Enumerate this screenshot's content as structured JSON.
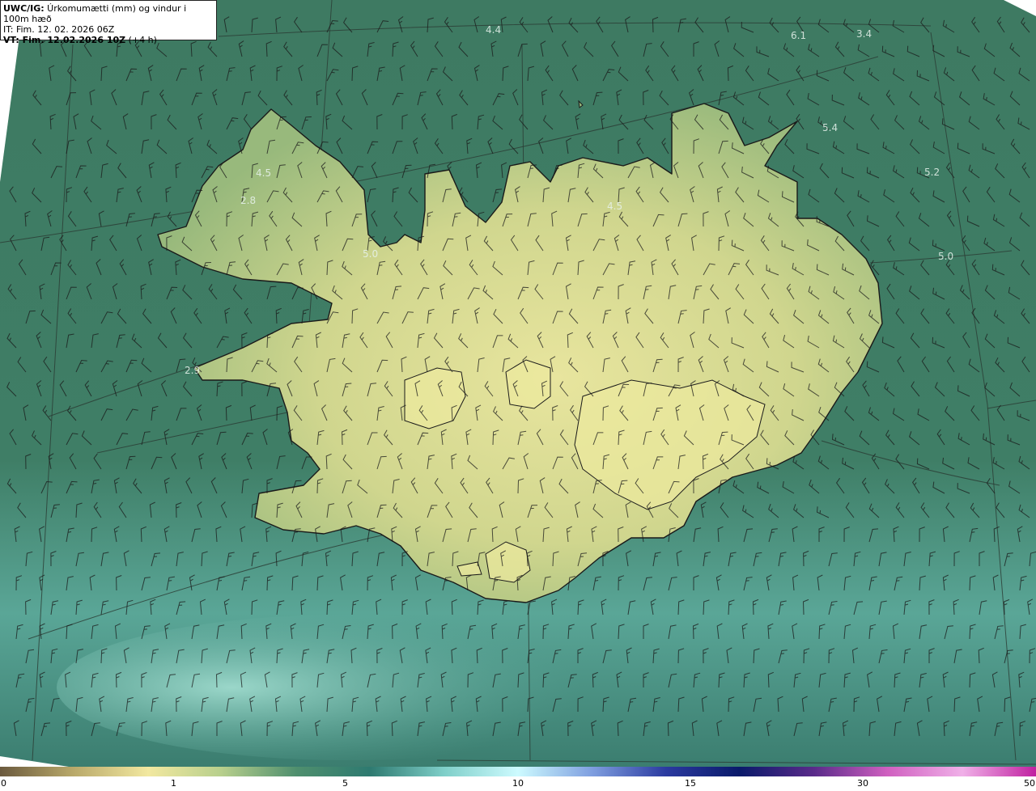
{
  "header": {
    "line1_prefix": "UWC/IG:",
    "line1_text": " Úrkomumætti (mm) og vindur i 100m hæð",
    "line2": "IT: Fim. 12. 02. 2026 06Z",
    "line3_prefix": "VT: Fim. 12.02.2026 10Z",
    "line3_suffix": " (+4 h)"
  },
  "point_labels": [
    "4.4",
    "6.1",
    "3.4",
    "5.4",
    "5.2",
    "4.5",
    "2.8",
    "5.0",
    "4.5",
    "5.0",
    "2.9"
  ],
  "colorbar": {
    "ticks": [
      "0",
      "1",
      "5",
      "10",
      "15",
      "30",
      "50"
    ],
    "colors": [
      "#6b5a3e",
      "#b9a96a",
      "#f2e8a0",
      "#b7cf8c",
      "#4f8f6e",
      "#2e7a70",
      "#7fcfc9",
      "#cdfbff",
      "#7f9fe0",
      "#2b3aa0",
      "#0a1a6a",
      "#5a2b8a",
      "#d060c0",
      "#f0b0e8",
      "#c020a0"
    ]
  },
  "colors": {
    "sea": "#3f7e66",
    "land_high": "#e6e39a",
    "land_mid": "#c4cf86",
    "coast": "#1a1a1a"
  }
}
